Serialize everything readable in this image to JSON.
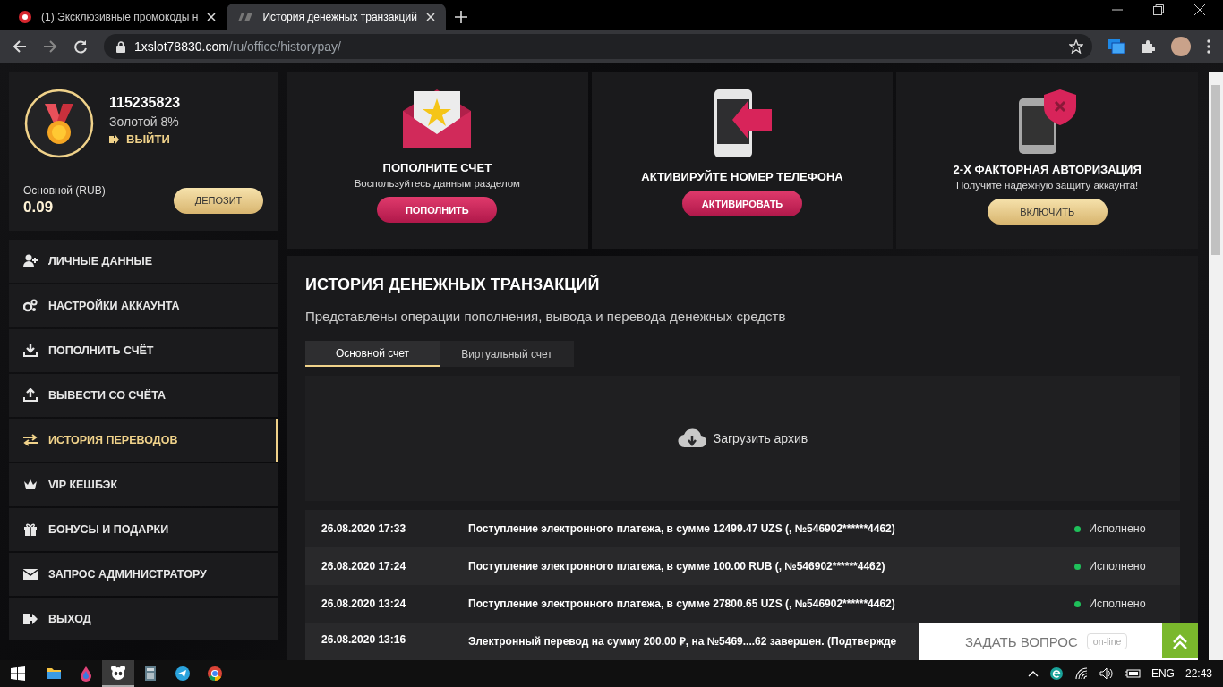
{
  "browser": {
    "tabs": [
      {
        "title": "(1) Эксклюзивные промокоды н",
        "kind": "casino",
        "selected": false
      },
      {
        "title": "История денежных транзакций",
        "kind": "brand",
        "selected": true
      }
    ],
    "address": {
      "host": "1xslot78830.com",
      "path": "/ru/office/historypay/"
    }
  },
  "profile": {
    "account_id": "115235823",
    "level": "Золотой 8%",
    "logout": "ВЫЙТИ",
    "balance_label": "Основной (RUB)",
    "balance": "0.09",
    "deposit_button": "ДЕПОЗИТ"
  },
  "menu": [
    {
      "label": "ЛИЧНЫЕ ДАННЫЕ",
      "kind": "user",
      "selected": false
    },
    {
      "label": "НАСТРОЙКИ АККАУНТА",
      "kind": "gears",
      "selected": false
    },
    {
      "label": "ПОПОЛНИТЬ СЧЁТ",
      "kind": "download",
      "selected": false
    },
    {
      "label": "ВЫВЕСТИ СО СЧЁТА",
      "kind": "upload",
      "selected": false
    },
    {
      "label": "ИСТОРИЯ ПЕРЕВОДОВ",
      "kind": "transfer",
      "selected": true
    },
    {
      "label": "VIP КЕШБЭК",
      "kind": "crown",
      "selected": false
    },
    {
      "label": "БОНУСЫ И ПОДАРКИ",
      "kind": "gift",
      "selected": false
    },
    {
      "label": "ЗАПРОС АДМИНИСТРАТОРУ",
      "kind": "mail",
      "selected": false
    },
    {
      "label": "ВЫХОД",
      "kind": "exit",
      "selected": false
    }
  ],
  "promos": [
    {
      "kind": "envelope",
      "title": "ПОПОЛНИТЕ СЧЕТ",
      "text": "Воспользуйтесь данным разделом",
      "button": "ПОПОЛНИТЬ"
    },
    {
      "kind": "phone",
      "title": "АКТИВИРУЙТЕ НОМЕР ТЕЛЕФОНА",
      "button": "АКТИВИРОВАТЬ"
    },
    {
      "kind": "shield",
      "title": "2-Х ФАКТОРНАЯ АВТОРИЗАЦИЯ",
      "text": "Получите надёжную защиту аккаунта!",
      "button": "ВКЛЮЧИТЬ"
    }
  ],
  "history": {
    "title": "ИСТОРИЯ ДЕНЕЖНЫХ ТРАНЗАКЦИЙ",
    "subtitle": "Представлены операции пополнения, вывода и перевода денежных средств",
    "tabs": [
      {
        "label": "Основной счет",
        "selected": true
      },
      {
        "label": "Виртуальный счет",
        "selected": false
      }
    ],
    "archive": "Загрузить архив",
    "rows": [
      {
        "date": "26.08.2020 17:33",
        "description": "Поступление электронного платежа, в сумме 12499.47 UZS (, №546902******4462)",
        "status": "Исполнено"
      },
      {
        "date": "26.08.2020 17:24",
        "description": "Поступление электронного платежа, в сумме 100.00 RUB (, №546902******4462)",
        "status": "Исполнено"
      },
      {
        "date": "26.08.2020 13:24",
        "description": "Поступление электронного платежа, в сумме 27800.65 UZS (, №546902******4462)",
        "status": "Исполнено"
      },
      {
        "date": "26.08.2020 13:16",
        "description": "Электронный перевод на сумму 200.00 ₽, на №5469....62 завершен. (Подтвержде"
      }
    ]
  },
  "chat": {
    "label": "ЗАДАТЬ ВОПРОС",
    "badge": "on-line"
  },
  "taskbar": {
    "apps": [
      {
        "kind": "folder",
        "selected": false
      },
      {
        "kind": "drop",
        "selected": false
      },
      {
        "kind": "panda",
        "selected": true
      },
      {
        "kind": "calculator",
        "selected": false
      },
      {
        "kind": "telegram",
        "selected": false
      },
      {
        "kind": "chrome",
        "selected": false
      }
    ],
    "language": "ENG",
    "time": "22:43"
  }
}
